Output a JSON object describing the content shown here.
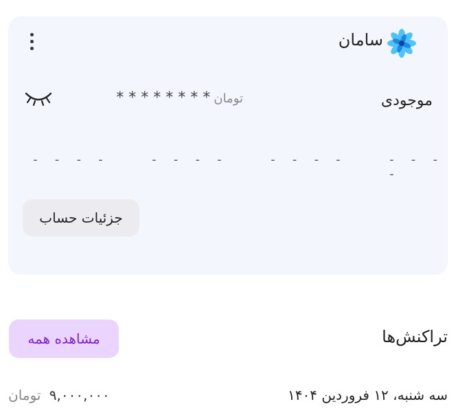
{
  "card": {
    "bank_name": "سامان",
    "bank_logo_icon": "saman-bank-logo-icon",
    "menu_icon": "kebab-menu-icon",
    "balance_label": "موجودی",
    "balance_masked": "* * * * * * * *",
    "balance_currency": "تومان",
    "visibility_icon": "eye-closed-icon",
    "placeholders": [
      "- - - -",
      "- - - -",
      "- - - -",
      "- - - -"
    ],
    "details_button": "جزئیات حساب"
  },
  "transactions": {
    "title": "تراکنش‌ها",
    "view_all_button": "مشاهده همه",
    "items": [
      {
        "date": "سه شنبه، ۱۲ فروردین ۱۴۰۴",
        "amount": "۹,۰۰۰,۰۰۰",
        "currency": "تومان"
      }
    ]
  },
  "colors": {
    "card_bg": "#f4f6fe",
    "accent_purple": "#7e22ce",
    "accent_purple_bg": "#e9d5ff",
    "button_grey": "#ececf0"
  }
}
